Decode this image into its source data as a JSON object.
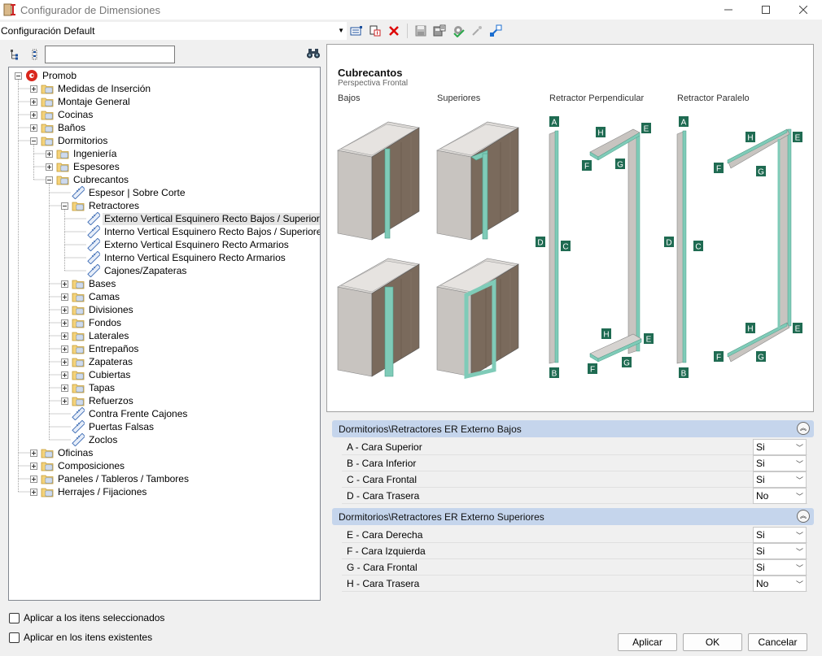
{
  "window": {
    "title": "Configurador de Dimensiones"
  },
  "toolbar": {
    "config_value": "Configuración Default"
  },
  "tree": {
    "nodes": [
      {
        "label": "Promob",
        "level": 0,
        "exp": "minus",
        "icon": "root"
      },
      {
        "label": "Medidas de Inserción",
        "level": 1,
        "exp": "plus",
        "icon": "folder"
      },
      {
        "label": "Montaje General",
        "level": 1,
        "exp": "plus",
        "icon": "folder"
      },
      {
        "label": "Cocinas",
        "level": 1,
        "exp": "plus",
        "icon": "folder"
      },
      {
        "label": "Baños",
        "level": 1,
        "exp": "plus",
        "icon": "folder"
      },
      {
        "label": "Dormitorios",
        "level": 1,
        "exp": "minus",
        "icon": "folder"
      },
      {
        "label": "Ingeniería",
        "level": 2,
        "exp": "plus",
        "icon": "folder"
      },
      {
        "label": "Espesores",
        "level": 2,
        "exp": "plus",
        "icon": "folder"
      },
      {
        "label": "Cubrecantos",
        "level": 2,
        "exp": "minus",
        "icon": "folder"
      },
      {
        "label": "Espesor | Sobre Corte",
        "level": 3,
        "exp": "none",
        "icon": "item"
      },
      {
        "label": "Retractores",
        "level": 3,
        "exp": "minus",
        "icon": "folder"
      },
      {
        "label": "Externo Vertical Esquinero Recto Bajos / Superiores",
        "level": 4,
        "exp": "none",
        "icon": "item",
        "selected": true
      },
      {
        "label": "Interno Vertical Esquinero Recto Bajos / Superiores",
        "level": 4,
        "exp": "none",
        "icon": "item"
      },
      {
        "label": "Externo Vertical Esquinero Recto Armarios",
        "level": 4,
        "exp": "none",
        "icon": "item"
      },
      {
        "label": "Interno Vertical Esquinero Recto Armarios",
        "level": 4,
        "exp": "none",
        "icon": "item"
      },
      {
        "label": "Cajones/Zapateras",
        "level": 4,
        "exp": "none",
        "icon": "item"
      },
      {
        "label": "Bases",
        "level": 3,
        "exp": "plus",
        "icon": "folder"
      },
      {
        "label": "Camas",
        "level": 3,
        "exp": "plus",
        "icon": "folder"
      },
      {
        "label": "Divisiones",
        "level": 3,
        "exp": "plus",
        "icon": "folder"
      },
      {
        "label": "Fondos",
        "level": 3,
        "exp": "plus",
        "icon": "folder"
      },
      {
        "label": "Laterales",
        "level": 3,
        "exp": "plus",
        "icon": "folder"
      },
      {
        "label": "Entrepaños",
        "level": 3,
        "exp": "plus",
        "icon": "folder"
      },
      {
        "label": "Zapateras",
        "level": 3,
        "exp": "plus",
        "icon": "folder"
      },
      {
        "label": "Cubiertas",
        "level": 3,
        "exp": "plus",
        "icon": "folder"
      },
      {
        "label": "Tapas",
        "level": 3,
        "exp": "plus",
        "icon": "folder"
      },
      {
        "label": "Refuerzos",
        "level": 3,
        "exp": "plus",
        "icon": "folder"
      },
      {
        "label": "Contra Frente Cajones",
        "level": 3,
        "exp": "none",
        "icon": "item"
      },
      {
        "label": "Puertas Falsas",
        "level": 3,
        "exp": "none",
        "icon": "item"
      },
      {
        "label": "Zoclos",
        "level": 3,
        "exp": "none",
        "icon": "item"
      },
      {
        "label": "Oficinas",
        "level": 1,
        "exp": "plus",
        "icon": "folder"
      },
      {
        "label": "Composiciones",
        "level": 1,
        "exp": "plus",
        "icon": "folder"
      },
      {
        "label": "Paneles / Tableros / Tambores",
        "level": 1,
        "exp": "plus",
        "icon": "folder"
      },
      {
        "label": "Herrajes / Fijaciones",
        "level": 1,
        "exp": "plus",
        "icon": "folder"
      }
    ]
  },
  "preview": {
    "title": "Cubrecantos",
    "subtitle": "Perspectiva Frontal",
    "columns": [
      "Bajos",
      "Superiores",
      "Retractor Perpendicular",
      "Retractor Paralelo"
    ]
  },
  "groups": [
    {
      "title": "Dormitorios\\Retractores ER Externo Bajos",
      "props": [
        {
          "name": "A - Cara Superior",
          "value": "Si"
        },
        {
          "name": "B - Cara Inferior",
          "value": "Si"
        },
        {
          "name": "C - Cara Frontal",
          "value": "Si"
        },
        {
          "name": "D - Cara Trasera",
          "value": "No"
        }
      ]
    },
    {
      "title": "Dormitorios\\Retractores ER Externo Superiores",
      "props": [
        {
          "name": "E - Cara Derecha",
          "value": "Si"
        },
        {
          "name": "F - Cara Izquierda",
          "value": "Si"
        },
        {
          "name": "G - Cara Frontal",
          "value": "Si"
        },
        {
          "name": "H - Cara Trasera",
          "value": "No"
        }
      ]
    }
  ],
  "footer": {
    "check1": "Aplicar a los itens seleccionados",
    "check2": "Aplicar en los itens existentes",
    "apply": "Aplicar",
    "ok": "OK",
    "cancel": "Cancelar"
  },
  "colors": {
    "accent_edge": "#7fcbb8",
    "group_header": "#c5d5ec",
    "label_box": "#1f6b52",
    "wood": "#7a6a5c"
  }
}
